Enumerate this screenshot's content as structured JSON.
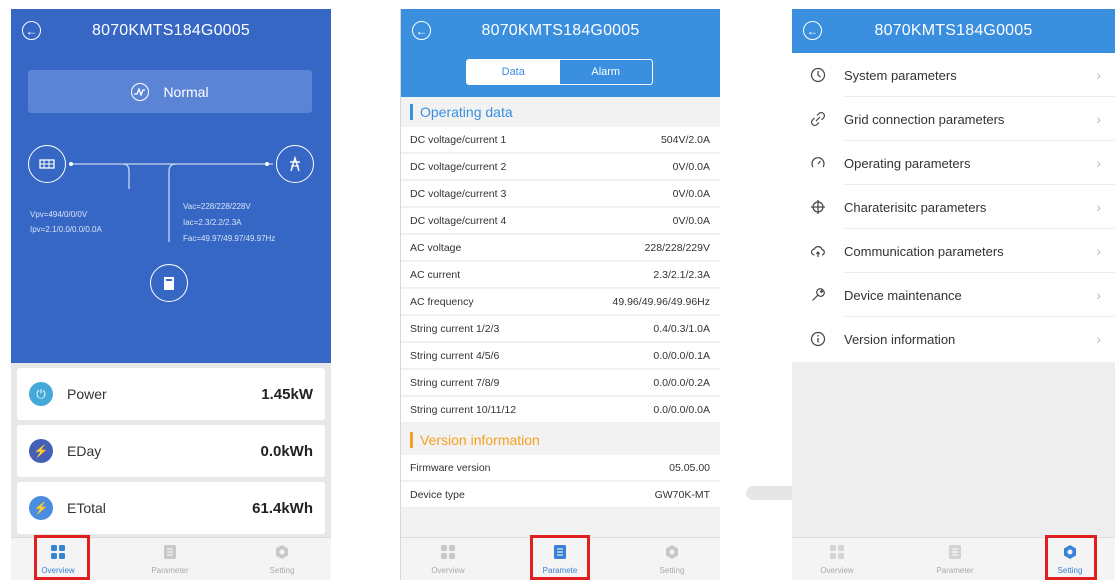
{
  "device_id": "8070KMTS184G0005",
  "overview": {
    "status": "Normal",
    "pv_voltage": "Vpv=494/0/0/0V",
    "pv_current": "Ipv=2.1/0.0/0.0/0.0A",
    "ac_voltage": "Vac=228/228/228V",
    "ac_current": "Iac=2.3/2.2/2.3A",
    "ac_freq": "Fac=49.97/49.97/49.97Hz",
    "cards": [
      {
        "label": "Power",
        "value": "1.45kW",
        "icon": "power-icon",
        "color": "#44a9d8"
      },
      {
        "label": "EDay",
        "value": "0.0kWh",
        "icon": "bolt-icon",
        "color": "#4460b8"
      },
      {
        "label": "ETotal",
        "value": "61.4kWh",
        "icon": "bolt-icon",
        "color": "#4a8de0"
      }
    ]
  },
  "tabs": {
    "overview": "Overview",
    "parameter": "Parameter",
    "parameter_truncated": "Paramete",
    "setting": "Setting"
  },
  "parameter": {
    "segments": {
      "data": "Data",
      "alarm": "Alarm"
    },
    "operating_title": "Operating data",
    "operating_color": "#3a8fde",
    "operating_rows": [
      {
        "label": "DC voltage/current 1",
        "value": "504V/2.0A"
      },
      {
        "label": "DC voltage/current 2",
        "value": "0V/0.0A"
      },
      {
        "label": "DC voltage/current 3",
        "value": "0V/0.0A"
      },
      {
        "label": "DC voltage/current 4",
        "value": "0V/0.0A"
      },
      {
        "label": "AC voltage",
        "value": "228/228/229V"
      },
      {
        "label": "AC current",
        "value": "2.3/2.1/2.3A"
      },
      {
        "label": "AC frequency",
        "value": "49.96/49.96/49.96Hz"
      },
      {
        "label": "String current 1/2/3",
        "value": "0.4/0.3/1.0A"
      },
      {
        "label": "String current 4/5/6",
        "value": "0.0/0.0/0.1A"
      },
      {
        "label": "String current 7/8/9",
        "value": "0.0/0.0/0.2A"
      },
      {
        "label": "String current 10/11/12",
        "value": "0.0/0.0/0.0A"
      }
    ],
    "version_title": "Version information",
    "version_color": "#f5a020",
    "version_rows": [
      {
        "label": "Firmware version",
        "value": "05.05.00"
      },
      {
        "label": "Device type",
        "value": "GW70K-MT"
      }
    ]
  },
  "setting": {
    "items": [
      {
        "label": "System parameters",
        "icon": "clock-icon"
      },
      {
        "label": "Grid connection parameters",
        "icon": "link-icon"
      },
      {
        "label": "Operating parameters",
        "icon": "gauge-icon"
      },
      {
        "label": "Charaterisitc parameters",
        "icon": "crosshair-icon"
      },
      {
        "label": "Communication parameters",
        "icon": "cloud-icon"
      },
      {
        "label": "Device maintenance",
        "icon": "wrench-icon"
      },
      {
        "label": "Version information",
        "icon": "info-icon"
      }
    ]
  }
}
